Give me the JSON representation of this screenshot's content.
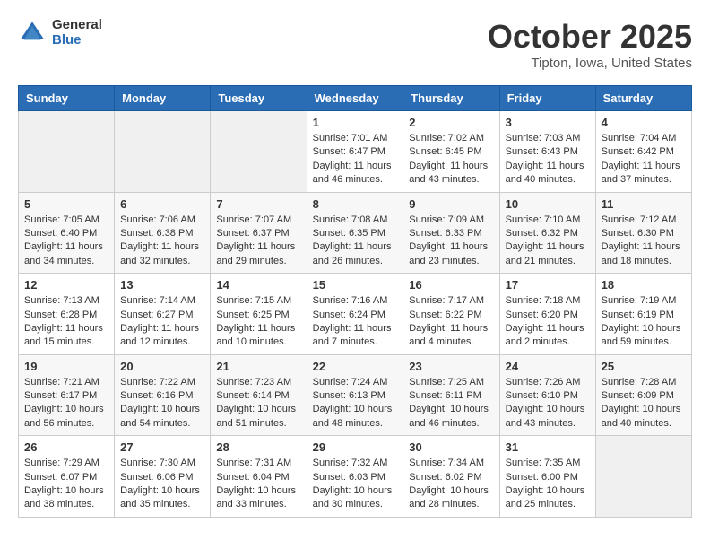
{
  "header": {
    "logo_general": "General",
    "logo_blue": "Blue",
    "month_title": "October 2025",
    "location": "Tipton, Iowa, United States"
  },
  "calendar": {
    "headers": [
      "Sunday",
      "Monday",
      "Tuesday",
      "Wednesday",
      "Thursday",
      "Friday",
      "Saturday"
    ],
    "weeks": [
      [
        {
          "day": "",
          "info": ""
        },
        {
          "day": "",
          "info": ""
        },
        {
          "day": "",
          "info": ""
        },
        {
          "day": "1",
          "info": "Sunrise: 7:01 AM\nSunset: 6:47 PM\nDaylight: 11 hours and 46 minutes."
        },
        {
          "day": "2",
          "info": "Sunrise: 7:02 AM\nSunset: 6:45 PM\nDaylight: 11 hours and 43 minutes."
        },
        {
          "day": "3",
          "info": "Sunrise: 7:03 AM\nSunset: 6:43 PM\nDaylight: 11 hours and 40 minutes."
        },
        {
          "day": "4",
          "info": "Sunrise: 7:04 AM\nSunset: 6:42 PM\nDaylight: 11 hours and 37 minutes."
        }
      ],
      [
        {
          "day": "5",
          "info": "Sunrise: 7:05 AM\nSunset: 6:40 PM\nDaylight: 11 hours and 34 minutes."
        },
        {
          "day": "6",
          "info": "Sunrise: 7:06 AM\nSunset: 6:38 PM\nDaylight: 11 hours and 32 minutes."
        },
        {
          "day": "7",
          "info": "Sunrise: 7:07 AM\nSunset: 6:37 PM\nDaylight: 11 hours and 29 minutes."
        },
        {
          "day": "8",
          "info": "Sunrise: 7:08 AM\nSunset: 6:35 PM\nDaylight: 11 hours and 26 minutes."
        },
        {
          "day": "9",
          "info": "Sunrise: 7:09 AM\nSunset: 6:33 PM\nDaylight: 11 hours and 23 minutes."
        },
        {
          "day": "10",
          "info": "Sunrise: 7:10 AM\nSunset: 6:32 PM\nDaylight: 11 hours and 21 minutes."
        },
        {
          "day": "11",
          "info": "Sunrise: 7:12 AM\nSunset: 6:30 PM\nDaylight: 11 hours and 18 minutes."
        }
      ],
      [
        {
          "day": "12",
          "info": "Sunrise: 7:13 AM\nSunset: 6:28 PM\nDaylight: 11 hours and 15 minutes."
        },
        {
          "day": "13",
          "info": "Sunrise: 7:14 AM\nSunset: 6:27 PM\nDaylight: 11 hours and 12 minutes."
        },
        {
          "day": "14",
          "info": "Sunrise: 7:15 AM\nSunset: 6:25 PM\nDaylight: 11 hours and 10 minutes."
        },
        {
          "day": "15",
          "info": "Sunrise: 7:16 AM\nSunset: 6:24 PM\nDaylight: 11 hours and 7 minutes."
        },
        {
          "day": "16",
          "info": "Sunrise: 7:17 AM\nSunset: 6:22 PM\nDaylight: 11 hours and 4 minutes."
        },
        {
          "day": "17",
          "info": "Sunrise: 7:18 AM\nSunset: 6:20 PM\nDaylight: 11 hours and 2 minutes."
        },
        {
          "day": "18",
          "info": "Sunrise: 7:19 AM\nSunset: 6:19 PM\nDaylight: 10 hours and 59 minutes."
        }
      ],
      [
        {
          "day": "19",
          "info": "Sunrise: 7:21 AM\nSunset: 6:17 PM\nDaylight: 10 hours and 56 minutes."
        },
        {
          "day": "20",
          "info": "Sunrise: 7:22 AM\nSunset: 6:16 PM\nDaylight: 10 hours and 54 minutes."
        },
        {
          "day": "21",
          "info": "Sunrise: 7:23 AM\nSunset: 6:14 PM\nDaylight: 10 hours and 51 minutes."
        },
        {
          "day": "22",
          "info": "Sunrise: 7:24 AM\nSunset: 6:13 PM\nDaylight: 10 hours and 48 minutes."
        },
        {
          "day": "23",
          "info": "Sunrise: 7:25 AM\nSunset: 6:11 PM\nDaylight: 10 hours and 46 minutes."
        },
        {
          "day": "24",
          "info": "Sunrise: 7:26 AM\nSunset: 6:10 PM\nDaylight: 10 hours and 43 minutes."
        },
        {
          "day": "25",
          "info": "Sunrise: 7:28 AM\nSunset: 6:09 PM\nDaylight: 10 hours and 40 minutes."
        }
      ],
      [
        {
          "day": "26",
          "info": "Sunrise: 7:29 AM\nSunset: 6:07 PM\nDaylight: 10 hours and 38 minutes."
        },
        {
          "day": "27",
          "info": "Sunrise: 7:30 AM\nSunset: 6:06 PM\nDaylight: 10 hours and 35 minutes."
        },
        {
          "day": "28",
          "info": "Sunrise: 7:31 AM\nSunset: 6:04 PM\nDaylight: 10 hours and 33 minutes."
        },
        {
          "day": "29",
          "info": "Sunrise: 7:32 AM\nSunset: 6:03 PM\nDaylight: 10 hours and 30 minutes."
        },
        {
          "day": "30",
          "info": "Sunrise: 7:34 AM\nSunset: 6:02 PM\nDaylight: 10 hours and 28 minutes."
        },
        {
          "day": "31",
          "info": "Sunrise: 7:35 AM\nSunset: 6:00 PM\nDaylight: 10 hours and 25 minutes."
        },
        {
          "day": "",
          "info": ""
        }
      ]
    ]
  }
}
